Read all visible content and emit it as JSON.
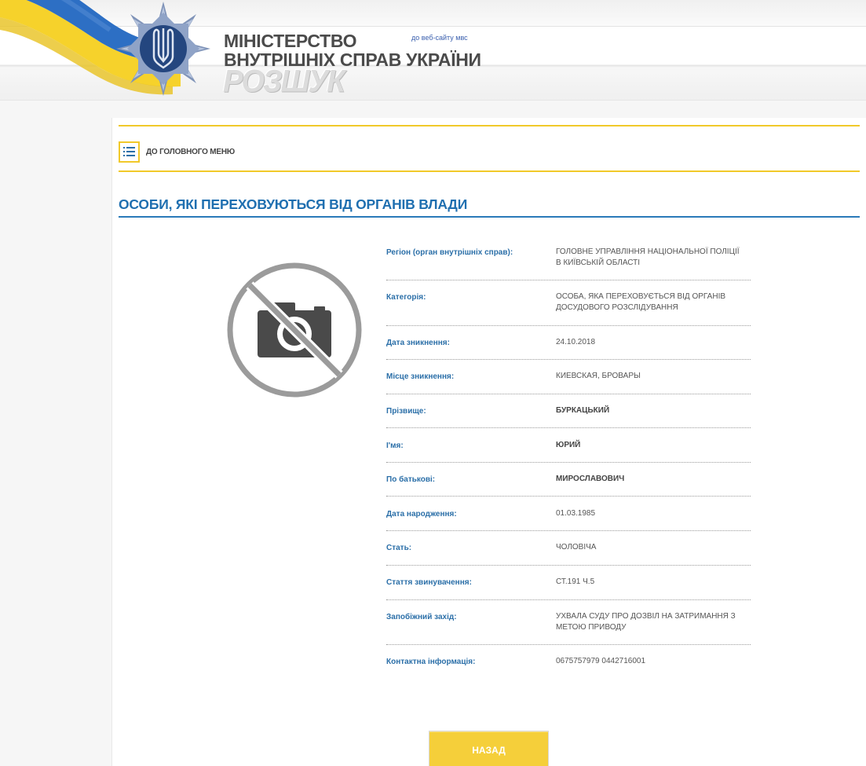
{
  "header": {
    "ministry_line1": "МІНІСТЕРСТВО",
    "ministry_line2": "ВНУТРІШНІХ СПРАВ УКРАЇНИ",
    "site_link": "до веб-сайту мвс",
    "section_logo": "РОЗШУК",
    "flag_colors": [
      "#2d6fc4",
      "#f6d22b"
    ],
    "emblem": "police-star-emblem-icon"
  },
  "nav": {
    "main_menu_label": "ДО ГОЛОВНОГО МЕНЮ",
    "main_menu_icon": "list-icon"
  },
  "page": {
    "title": "ОСОБИ, ЯКІ ПЕРЕХОВУЮТЬСЯ ВІД ОРГАНІВ ВЛАДИ",
    "photo_icon": "no-photo-icon"
  },
  "details": [
    {
      "label": "Регіон (орган внутрішніх справ):",
      "value": "ГОЛОВНЕ УПРАВЛІННЯ НАЦІОНАЛЬНОЇ ПОЛІЦІЇ В КИЇВСЬКІЙ ОБЛАСТІ"
    },
    {
      "label": "Категорія:",
      "value": "ОСОБА, ЯКА ПЕРЕХОВУЄТЬСЯ ВІД ОРГАНІВ ДОСУДОВОГО РОЗСЛІДУВАННЯ"
    },
    {
      "label": "Дата зникнення:",
      "value": "24.10.2018"
    },
    {
      "label": "Місце зникнення:",
      "value": "КИЕВСКАЯ, БРОВАРЫ"
    },
    {
      "label": "Прізвище:",
      "value": "БУРКАЦЬКИЙ"
    },
    {
      "label": "І'мя:",
      "value": "ЮРИЙ"
    },
    {
      "label": "По батькові:",
      "value": "МИРОСЛАВОВИЧ"
    },
    {
      "label": "Дата народження:",
      "value": "01.03.1985"
    },
    {
      "label": "Стать:",
      "value": "ЧОЛОВІЧА"
    },
    {
      "label": "Стаття звинувачення:",
      "value": "СТ.191 Ч.5"
    },
    {
      "label": "Запобіжний захід:",
      "value": "УХВАЛА СУДУ ПРО ДОЗВІЛ НА ЗАТРИМАННЯ З МЕТОЮ ПРИВОДУ"
    },
    {
      "label": "Контактна інформація:",
      "value": "0675757979 0442716001"
    }
  ],
  "actions": {
    "back_label": "НАЗАД"
  },
  "colors": {
    "accent_gold": "#f1c92a",
    "title_blue": "#1f6fb0",
    "label_blue": "#2b6fa8",
    "button_yellow": "#f5cf3a"
  }
}
